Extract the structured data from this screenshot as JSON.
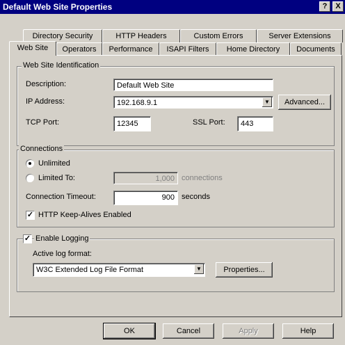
{
  "window": {
    "title": "Default Web Site Properties"
  },
  "title_buttons": {
    "help": "?",
    "close": "X"
  },
  "tabs_back": [
    "Directory Security",
    "HTTP Headers",
    "Custom Errors",
    "Server Extensions"
  ],
  "tabs_front": [
    "Web Site",
    "Operators",
    "Performance",
    "ISAPI Filters",
    "Home Directory",
    "Documents"
  ],
  "identification": {
    "legend": "Web Site Identification",
    "description_label": "Description:",
    "description_value": "Default Web Site",
    "ip_label": "IP Address:",
    "ip_value": "192.168.9.1",
    "advanced_button": "Advanced...",
    "tcp_label": "TCP Port:",
    "tcp_value": "12345",
    "ssl_label": "SSL Port:",
    "ssl_value": "443"
  },
  "connections": {
    "legend": "Connections",
    "unlimited": "Unlimited",
    "limited_to": "Limited To:",
    "limit_value": "1,000",
    "limit_unit": "connections",
    "timeout_label": "Connection Timeout:",
    "timeout_value": "900",
    "timeout_unit": "seconds",
    "keepalive": "HTTP Keep-Alives Enabled"
  },
  "logging": {
    "enable": "Enable Logging",
    "format_label": "Active log format:",
    "format_value": "W3C Extended Log File Format",
    "properties_button": "Properties..."
  },
  "footer": {
    "ok": "OK",
    "cancel": "Cancel",
    "apply": "Apply",
    "help": "Help"
  }
}
